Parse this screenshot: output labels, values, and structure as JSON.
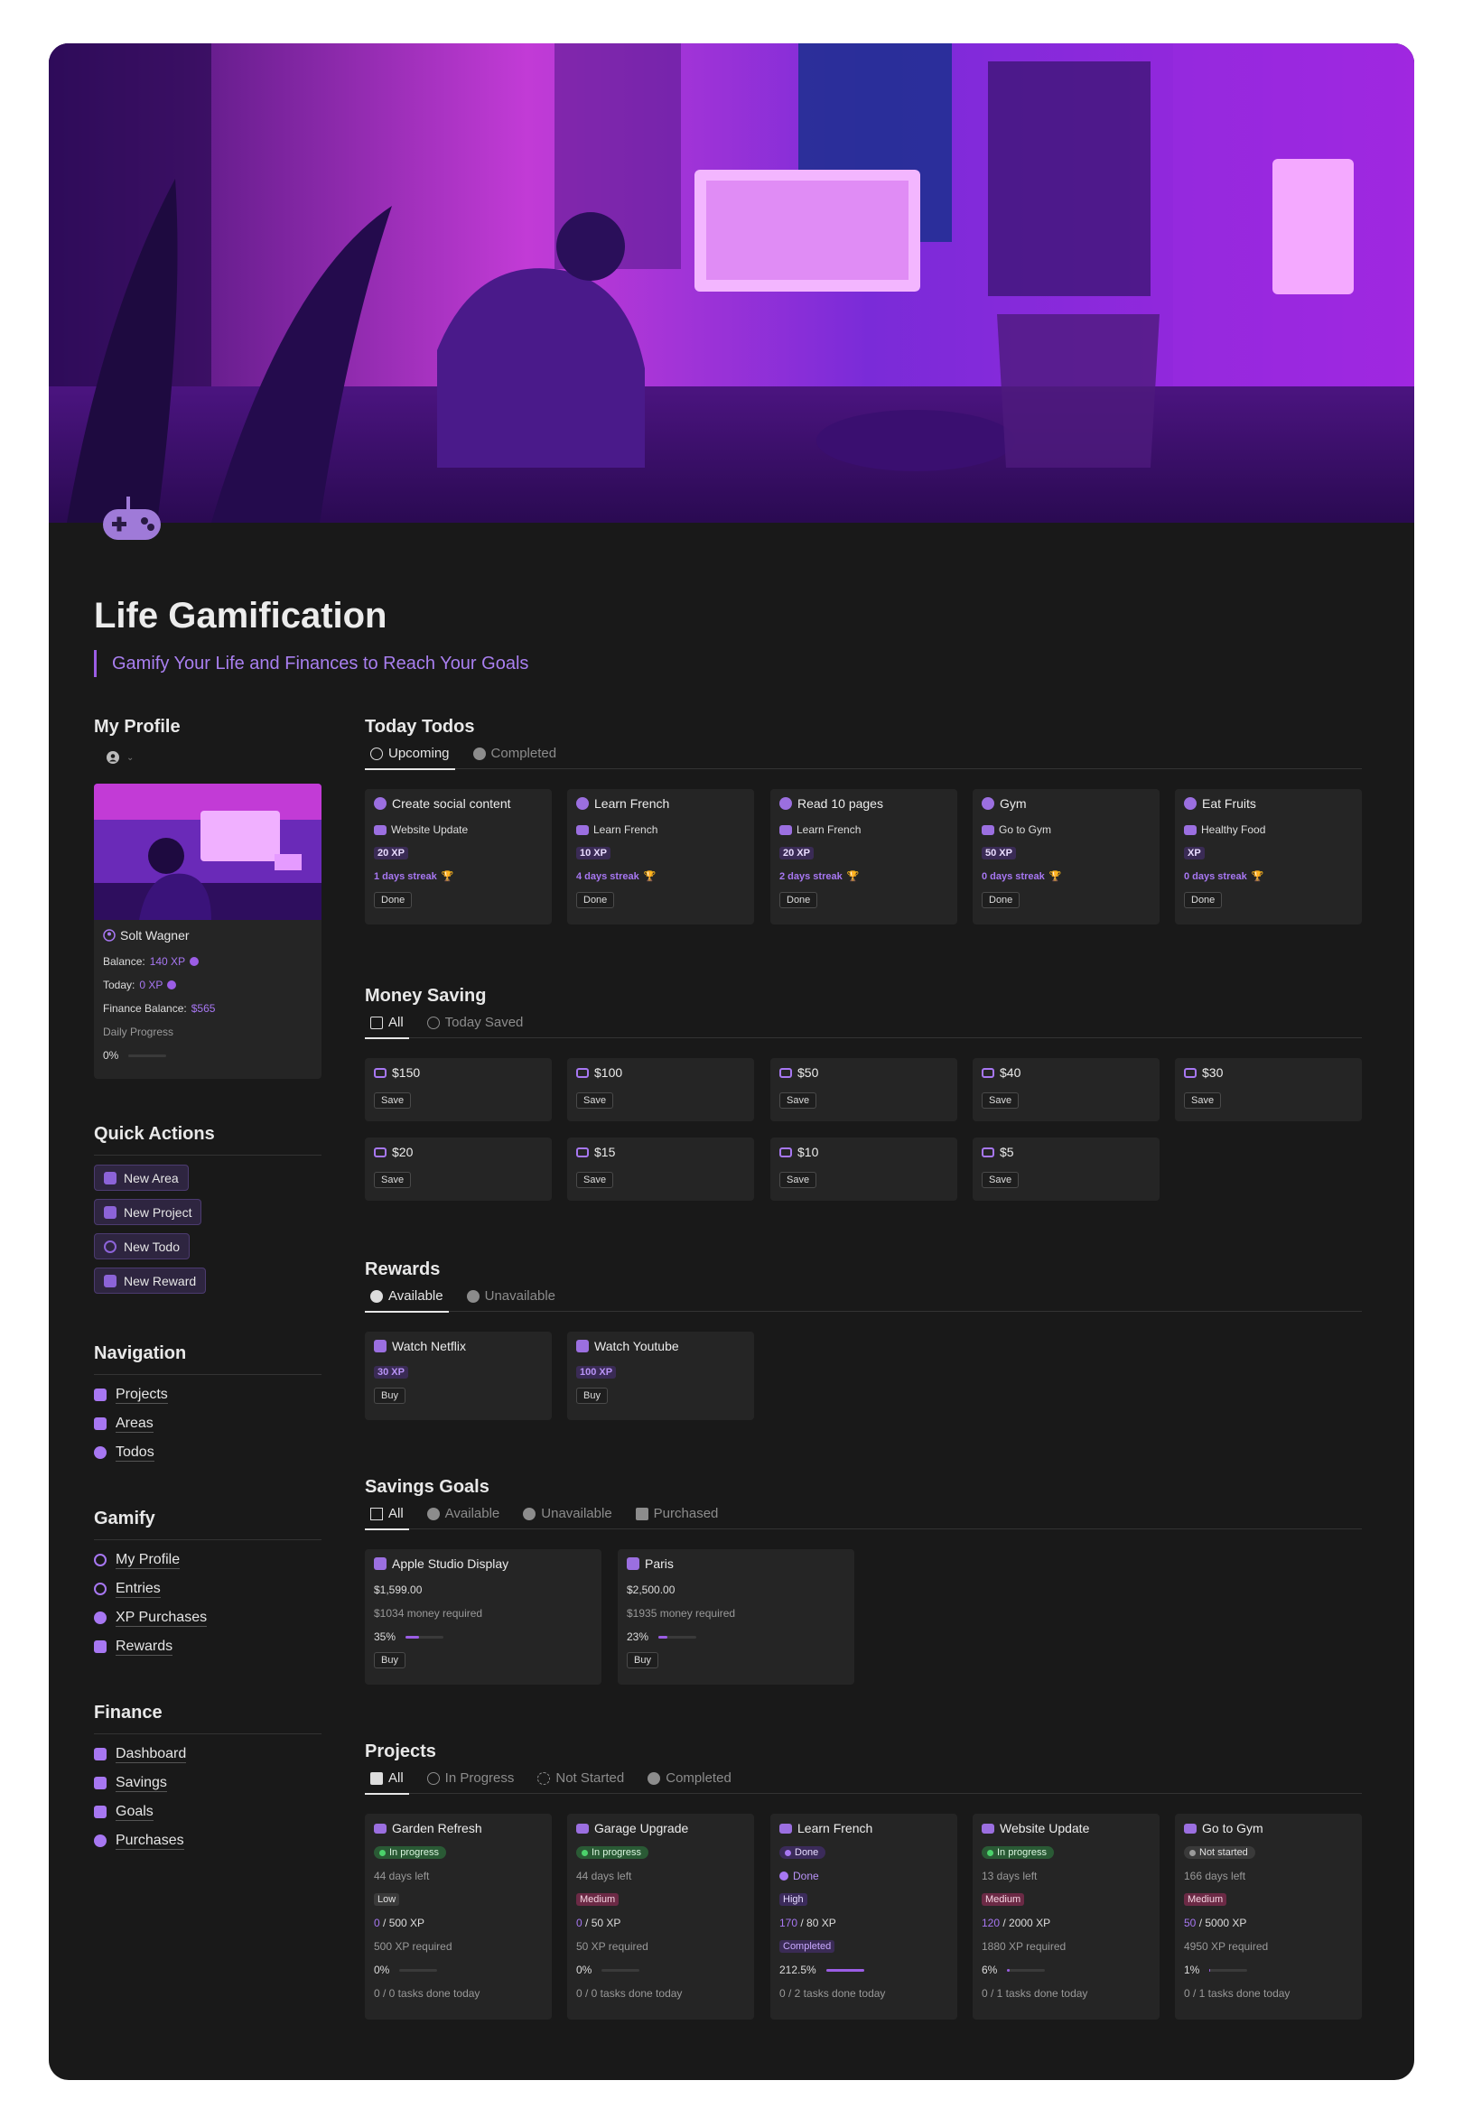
{
  "page": {
    "title": "Life Gamification",
    "subtitle": "Gamify Your Life and Finances to Reach Your Goals"
  },
  "colors": {
    "accent": "#9b5de5",
    "frame": "#191919",
    "card": "#252525",
    "in_progress": "#2f6b3c",
    "medium": "#6b2a45"
  },
  "icons": [
    "game-controller-icon",
    "person-icon",
    "folder-icon",
    "layers-icon",
    "circle-icon",
    "trophy-icon",
    "check-circle-icon",
    "money-icon",
    "clock-icon",
    "plus-circle-icon",
    "minus-circle-icon",
    "gift-icon",
    "tv-icon",
    "monitor-icon",
    "plane-icon"
  ],
  "profile": {
    "heading": "My Profile",
    "name": "Solt Wagner",
    "balance_label": "Balance:",
    "balance_value": "140 XP",
    "today_label": "Today:",
    "today_value": "0 XP",
    "finance_label": "Finance Balance:",
    "finance_value": "$565",
    "daily_label": "Daily Progress",
    "daily_value": "0%",
    "daily_progress": 0
  },
  "quick_actions": {
    "heading": "Quick Actions",
    "items": [
      {
        "label": "New Area"
      },
      {
        "label": "New Project"
      },
      {
        "label": "New Todo"
      },
      {
        "label": "New Reward"
      }
    ]
  },
  "navigation": {
    "heading": "Navigation",
    "items": [
      {
        "label": "Projects"
      },
      {
        "label": "Areas"
      },
      {
        "label": "Todos"
      }
    ]
  },
  "gamify": {
    "heading": "Gamify",
    "items": [
      {
        "label": "My Profile"
      },
      {
        "label": "Entries"
      },
      {
        "label": "XP Purchases"
      },
      {
        "label": "Rewards"
      }
    ]
  },
  "finance": {
    "heading": "Finance",
    "items": [
      {
        "label": "Dashboard"
      },
      {
        "label": "Savings"
      },
      {
        "label": "Goals"
      },
      {
        "label": "Purchases"
      }
    ]
  },
  "todos": {
    "heading": "Today Todos",
    "tabs": [
      {
        "label": "Upcoming"
      },
      {
        "label": "Completed"
      }
    ],
    "cards": [
      {
        "title": "Create social content",
        "project": "Website Update",
        "xp": "20 XP",
        "streak": "1 days streak",
        "button": "Done"
      },
      {
        "title": "Learn French",
        "project": "Learn French",
        "xp": "10 XP",
        "streak": "4 days streak",
        "button": "Done"
      },
      {
        "title": "Read 10 pages",
        "project": "Learn French",
        "xp": "20 XP",
        "streak": "2 days streak",
        "button": "Done"
      },
      {
        "title": "Gym",
        "project": "Go to Gym",
        "xp": "50 XP",
        "streak": "0 days streak",
        "button": "Done"
      },
      {
        "title": "Eat Fruits",
        "project": "Healthy Food",
        "xp": "XP",
        "streak": "0 days streak",
        "button": "Done"
      }
    ]
  },
  "money": {
    "heading": "Money Saving",
    "tabs": [
      {
        "label": "All"
      },
      {
        "label": "Today Saved"
      }
    ],
    "cards": [
      {
        "amount": "$150",
        "button": "Save"
      },
      {
        "amount": "$100",
        "button": "Save"
      },
      {
        "amount": "$50",
        "button": "Save"
      },
      {
        "amount": "$40",
        "button": "Save"
      },
      {
        "amount": "$30",
        "button": "Save"
      },
      {
        "amount": "$20",
        "button": "Save"
      },
      {
        "amount": "$15",
        "button": "Save"
      },
      {
        "amount": "$10",
        "button": "Save"
      },
      {
        "amount": "$5",
        "button": "Save"
      }
    ]
  },
  "rewards": {
    "heading": "Rewards",
    "tabs": [
      {
        "label": "Available"
      },
      {
        "label": "Unavailable"
      }
    ],
    "cards": [
      {
        "title": "Watch Netflix",
        "xp": "30 XP",
        "button": "Buy"
      },
      {
        "title": "Watch Youtube",
        "xp": "100 XP",
        "button": "Buy"
      }
    ]
  },
  "savings": {
    "heading": "Savings Goals",
    "tabs": [
      {
        "label": "All"
      },
      {
        "label": "Available"
      },
      {
        "label": "Unavailable"
      },
      {
        "label": "Purchased"
      }
    ],
    "cards": [
      {
        "title": "Apple Studio Display",
        "price": "$1,599.00",
        "required": "$1034 money required",
        "progress_label": "35%",
        "progress": 0.35,
        "button": "Buy"
      },
      {
        "title": "Paris",
        "price": "$2,500.00",
        "required": "$1935 money required",
        "progress_label": "23%",
        "progress": 0.23,
        "button": "Buy"
      }
    ]
  },
  "projects": {
    "heading": "Projects",
    "tabs": [
      {
        "label": "All"
      },
      {
        "label": "In Progress"
      },
      {
        "label": "Not Started"
      },
      {
        "label": "Completed"
      }
    ],
    "cards": [
      {
        "title": "Garden Refresh",
        "status": "In progress",
        "days": "44 days left",
        "priority": "Low",
        "xp_current": "0",
        "xp_total": " / 500 XP",
        "required": "500 XP required",
        "progress_label": "0%",
        "progress": 0,
        "tasks": "0 / 0 tasks done today"
      },
      {
        "title": "Garage Upgrade",
        "status": "In progress",
        "days": "44 days left",
        "priority": "Medium",
        "xp_current": "0",
        "xp_total": " / 50 XP",
        "required": "50 XP required",
        "progress_label": "0%",
        "progress": 0,
        "tasks": "0 / 0 tasks done today"
      },
      {
        "title": "Learn French",
        "status": "Done",
        "days": "Done",
        "priority": "High",
        "xp_current": "170",
        "xp_total": " / 80 XP",
        "required": "Completed",
        "progress_label": "212.5%",
        "progress": 1,
        "tasks": "0 / 2 tasks done today"
      },
      {
        "title": "Website Update",
        "status": "In progress",
        "days": "13 days left",
        "priority": "Medium",
        "xp_current": "120",
        "xp_total": " / 2000 XP",
        "required": "1880 XP required",
        "progress_label": "6%",
        "progress": 0.06,
        "tasks": "0 / 1 tasks done today"
      },
      {
        "title": "Go to Gym",
        "status": "Not started",
        "days": "166 days left",
        "priority": "Medium",
        "xp_current": "50",
        "xp_total": " / 5000 XP",
        "required": "4950 XP required",
        "progress_label": "1%",
        "progress": 0.01,
        "tasks": "0 / 1 tasks done today"
      }
    ]
  }
}
